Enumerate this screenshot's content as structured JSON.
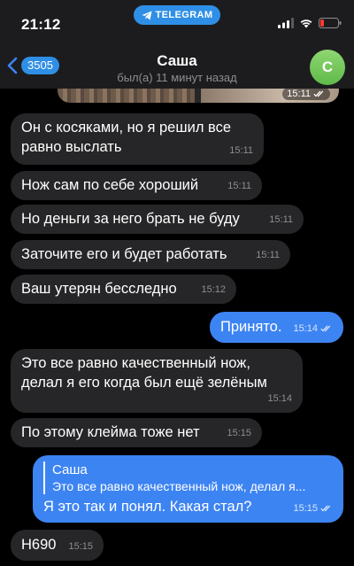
{
  "status_bar": {
    "time": "21:12",
    "app_pill": "TELEGRAM",
    "icons": [
      "signal-icon",
      "wifi-icon",
      "battery-icon"
    ],
    "battery_color": "#ff3b30"
  },
  "header": {
    "back_count": "3505",
    "title": "Саша",
    "subtitle": "был(а) 11 минут назад",
    "avatar_letter": "С"
  },
  "colors": {
    "accent": "#3d84f3",
    "incoming_bubble": "#262628",
    "background": "#000000"
  },
  "photo_message": {
    "time": "15:11",
    "read": true
  },
  "messages": [
    {
      "direction": "in",
      "lines": [
        "Он с косяками, но я решил все",
        "равно выслать"
      ],
      "time": "15:11"
    },
    {
      "direction": "in",
      "lines": [
        "Нож сам по себе хороший"
      ],
      "time": "15:11"
    },
    {
      "direction": "in",
      "lines": [
        "Но деньги за него брать не буду"
      ],
      "time": "15:11"
    },
    {
      "direction": "in",
      "lines": [
        "Заточите его и будет работать"
      ],
      "time": "15:11"
    },
    {
      "direction": "in",
      "lines": [
        "Ваш утерян бесследно"
      ],
      "time": "15:12"
    },
    {
      "direction": "out",
      "lines": [
        "Принято."
      ],
      "time": "15:14",
      "read": true
    },
    {
      "direction": "in",
      "lines": [
        "Это все равно качественный нож,",
        "делал я его когда был ещё зелёным"
      ],
      "time": "15:14"
    },
    {
      "direction": "in",
      "lines": [
        "По этому клейма тоже нет"
      ],
      "time": "15:15"
    },
    {
      "direction": "out",
      "reply_to": {
        "name": "Саша",
        "text": "Это все равно качественный нож, делал я..."
      },
      "lines": [
        "Я это так и понял. Какая стал?"
      ],
      "time": "15:15",
      "read": true
    },
    {
      "direction": "in",
      "lines": [
        "Н690"
      ],
      "time": "15:15"
    }
  ]
}
